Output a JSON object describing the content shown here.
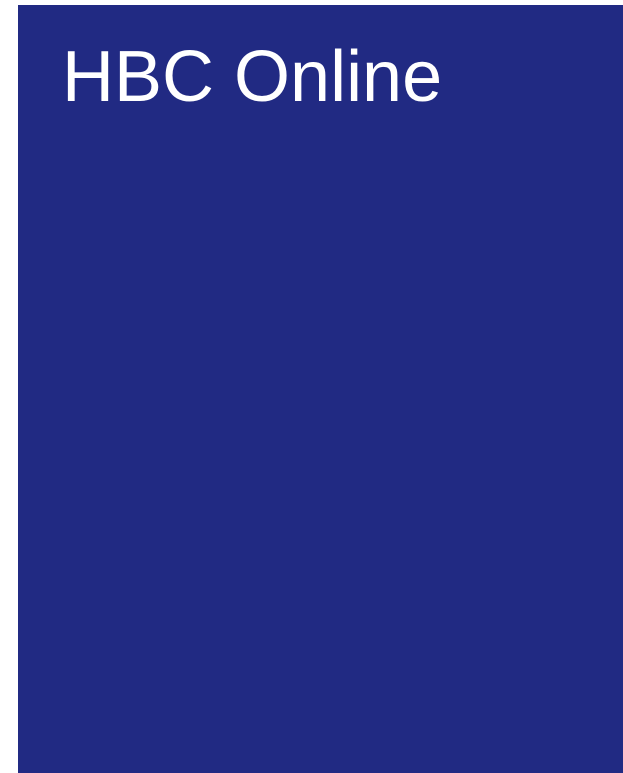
{
  "title": "HBC Online",
  "colors": {
    "panel_background": "#212a83",
    "title_text": "#ffffff",
    "page_background": "#ffffff"
  }
}
